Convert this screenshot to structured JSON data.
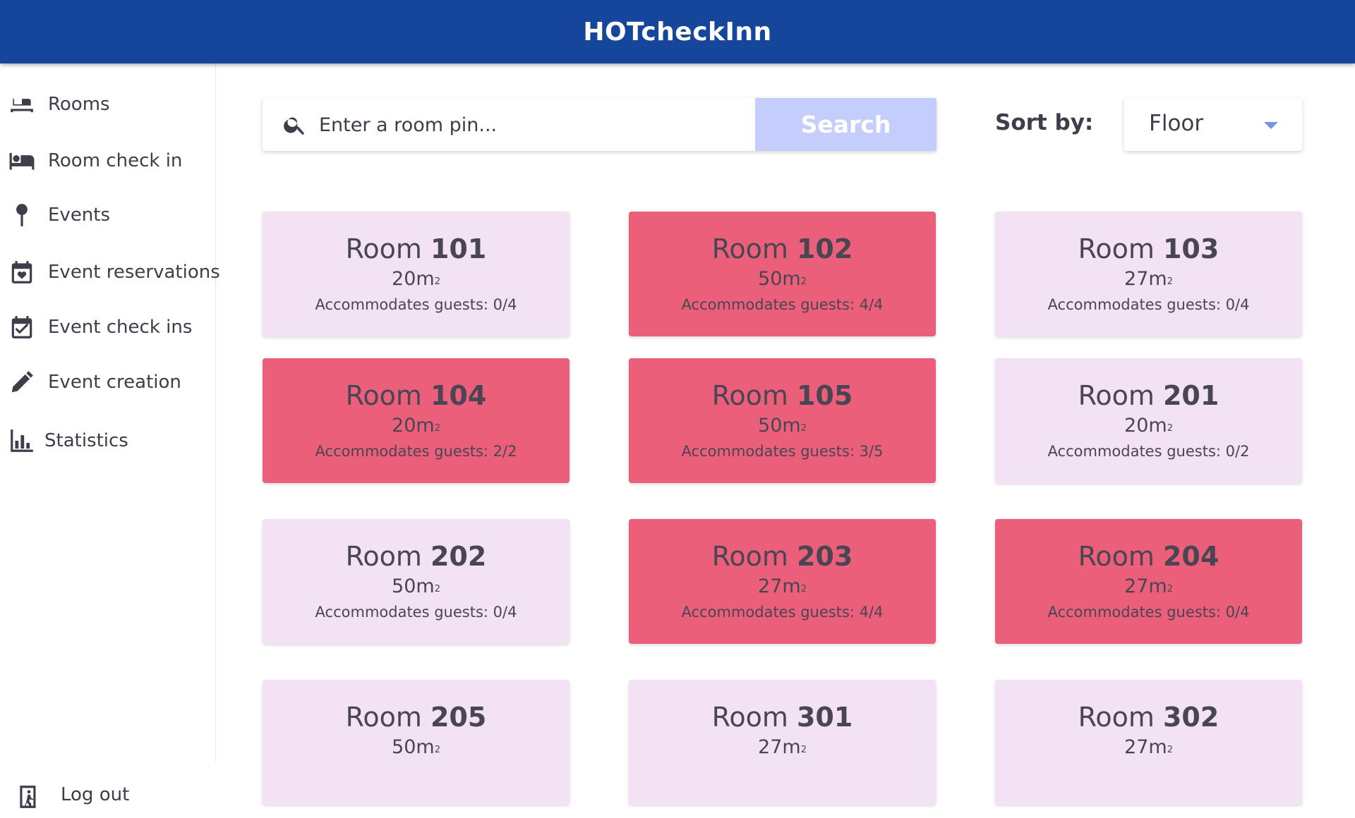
{
  "app": {
    "title": "HOTcheckInn"
  },
  "sidebar": {
    "items": [
      {
        "label": "Rooms",
        "icon": "bed-icon"
      },
      {
        "label": "Room check in",
        "icon": "bed-checkin-icon"
      },
      {
        "label": "Events",
        "icon": "map-pin-icon"
      },
      {
        "label": "Event reservations",
        "icon": "calendar-heart-icon"
      },
      {
        "label": "Event check ins",
        "icon": "calendar-check-icon"
      },
      {
        "label": "Event creation",
        "icon": "pencil-icon"
      },
      {
        "label": "Statistics",
        "icon": "bar-chart-icon"
      }
    ],
    "logout": {
      "label": "Log out",
      "icon": "exit-icon"
    }
  },
  "search": {
    "placeholder": "Enter a room pin...",
    "button_label": "Search"
  },
  "sort": {
    "label": "Sort by:",
    "value": "Floor"
  },
  "rooms": [
    {
      "prefix": "Room",
      "number": "101",
      "size": "20m",
      "guests": "Accommodates guests: 0/4",
      "status": "free"
    },
    {
      "prefix": "Room",
      "number": "102",
      "size": "50m",
      "guests": "Accommodates guests: 4/4",
      "status": "occupied"
    },
    {
      "prefix": "Room",
      "number": "103",
      "size": "27m",
      "guests": "Accommodates guests: 0/4",
      "status": "free"
    },
    {
      "prefix": "Room",
      "number": "104",
      "size": "20m",
      "guests": "Accommodates guests: 2/2",
      "status": "occupied"
    },
    {
      "prefix": "Room",
      "number": "105",
      "size": "50m",
      "guests": "Accommodates guests: 3/5",
      "status": "occupied"
    },
    {
      "prefix": "Room",
      "number": "201",
      "size": "20m",
      "guests": "Accommodates guests: 0/2",
      "status": "free"
    },
    {
      "prefix": "Room",
      "number": "202",
      "size": "50m",
      "guests": "Accommodates guests: 0/4",
      "status": "free"
    },
    {
      "prefix": "Room",
      "number": "203",
      "size": "27m",
      "guests": "Accommodates guests: 4/4",
      "status": "occupied"
    },
    {
      "prefix": "Room",
      "number": "204",
      "size": "27m",
      "guests": "Accommodates guests: 0/4",
      "status": "occupied"
    },
    {
      "prefix": "Room",
      "number": "205",
      "size": "50m",
      "guests": "",
      "status": "free"
    },
    {
      "prefix": "Room",
      "number": "301",
      "size": "27m",
      "guests": "",
      "status": "free"
    },
    {
      "prefix": "Room",
      "number": "302",
      "size": "27m",
      "guests": "",
      "status": "free"
    }
  ],
  "size_unit_exponent": "2",
  "colors": {
    "header": "#16459c",
    "free": "#f2e2f4",
    "occupied": "#eb5f7a",
    "search_button": "#c5cdfc"
  }
}
